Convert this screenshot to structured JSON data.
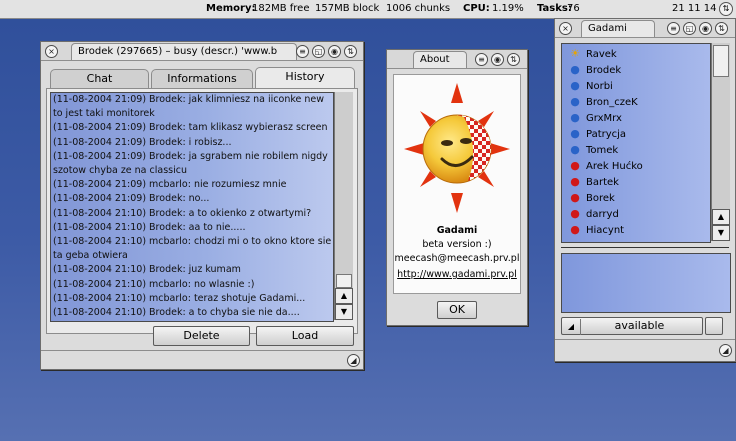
{
  "topbar": {
    "memory_label": "Memory:",
    "memory_free": "182MB free",
    "memory_block": "157MB block",
    "chunks": "1006 chunks",
    "cpu_label": "CPU:",
    "cpu_value": "1.19%",
    "tasks_label": "Tasks:",
    "tasks_value": "76",
    "clock": "21 11 14"
  },
  "chat_window": {
    "title": "Brodek (297665) – busy (descr.) 'www.b",
    "tabs": [
      {
        "label": "Chat"
      },
      {
        "label": "Informations"
      },
      {
        "label": "History"
      }
    ],
    "history": [
      "(11-08-2004 21:09) Brodek: jak klimniesz na iiconke new to jest taki monitorek",
      "(11-08-2004 21:09) Brodek: tam klikasz wybierasz screen",
      "(11-08-2004 21:09) Brodek: i robisz...",
      "(11-08-2004 21:09) Brodek: ja sgrabem nie robilem nigdy szotow chyba ze na classicu",
      "(11-08-2004 21:09) mcbarlo: nie rozumiesz mnie",
      "(11-08-2004 21:09) Brodek: no...",
      "(11-08-2004 21:10) Brodek: a to okienko z otwartymi?",
      "(11-08-2004 21:10) Brodek: aa to nie.....",
      "(11-08-2004 21:10) mcbarlo: chodzi mi o to okno ktore sie ta geba otwiera",
      "(11-08-2004 21:10) Brodek: juz kumam",
      "(11-08-2004 21:10) mcbarlo: no wlasnie :)",
      "(11-08-2004 21:10) mcbarlo: teraz shotuje Gadami...",
      "(11-08-2004 21:10) Brodek: a to chyba sie nie da...."
    ],
    "delete_label": "Delete",
    "load_label": "Load"
  },
  "about_window": {
    "title": "About",
    "app_name": "Gadami",
    "version": "beta version :)",
    "email": "meecash@meecash.prv.pl",
    "url": "http://www.gadami.prv.pl",
    "ok_label": "OK"
  },
  "contacts_window": {
    "title": "Gadami",
    "contacts": [
      {
        "name": "Ravek",
        "icon": "sun-status-icon",
        "color": "#e8a400"
      },
      {
        "name": "Brodek",
        "icon": "busy-user-icon",
        "color": "#2a63c8"
      },
      {
        "name": "Norbi",
        "icon": "busy-user-icon",
        "color": "#2a63c8"
      },
      {
        "name": "Bron_czeK",
        "icon": "busy-user-icon",
        "color": "#2a63c8"
      },
      {
        "name": "GrxMrx",
        "icon": "busy-user-icon",
        "color": "#2a63c8"
      },
      {
        "name": "Patrycja",
        "icon": "busy-user-icon",
        "color": "#2a63c8"
      },
      {
        "name": "Tomek",
        "icon": "busy-user-icon",
        "color": "#2a63c8"
      },
      {
        "name": "Arek Hućko",
        "icon": "offline-user-icon",
        "color": "#d01818"
      },
      {
        "name": "Bartek",
        "icon": "offline-user-icon",
        "color": "#d01818"
      },
      {
        "name": "Borek",
        "icon": "offline-user-icon",
        "color": "#d01818"
      },
      {
        "name": "darryd",
        "icon": "offline-user-icon",
        "color": "#d01818"
      },
      {
        "name": "Hiacynt",
        "icon": "offline-user-icon",
        "color": "#d01818"
      }
    ],
    "status_label": "available"
  },
  "colors": {
    "desktop": "#3d5ba6",
    "history_bg": "#8ea3dd",
    "list_bg": "#8aa0e0"
  }
}
